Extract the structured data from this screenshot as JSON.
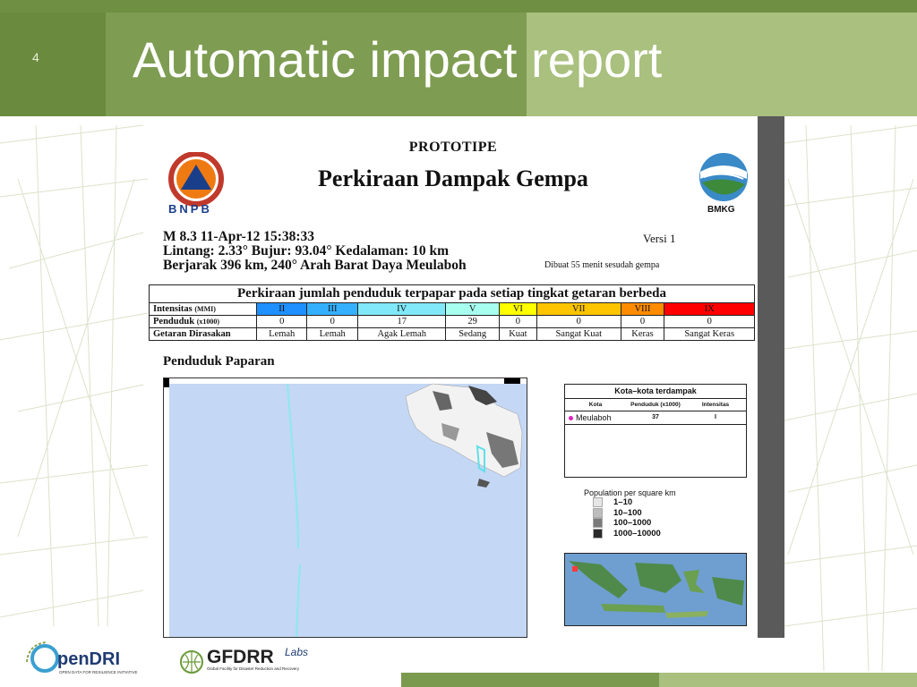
{
  "slide": {
    "number": "4",
    "title": "Automatic impact report"
  },
  "document": {
    "prototipe": "PROTOTIPE",
    "title": "Perkiraan Dampak Gempa",
    "bnpb_label": "BNPB",
    "bmkg_label": "BMKG",
    "quake_line1": "M 8.3 11-Apr-12 15:38:33",
    "quake_line2": "Lintang: 2.33° Bujur: 93.04° Kedalaman: 10 km",
    "quake_line3": "Berjarak 396 km, 240° Arah Barat Daya Meulaboh",
    "versi": "Versi 1",
    "dibuat": "Dibuat 55 menit sesudah gempa",
    "table_caption": "Perkiraan jumlah penduduk terpapar pada setiap tingkat getaran berbeda",
    "row_labels": {
      "intensitas": "Intensitas",
      "intensitas_unit": "(MMI)",
      "penduduk": "Penduduk",
      "penduduk_unit": "(x1000)",
      "getaran": "Getaran Dirasakan"
    },
    "intensity_levels": [
      {
        "level": "II",
        "penduduk": "0",
        "getaran": "Lemah",
        "color": "#1e90ff"
      },
      {
        "level": "III",
        "penduduk": "0",
        "getaran": "Lemah",
        "color": "#35b0ff"
      },
      {
        "level": "IV",
        "penduduk": "17",
        "getaran": "Agak Lemah",
        "color": "#80e8f8"
      },
      {
        "level": "V",
        "penduduk": "29",
        "getaran": "Sedang",
        "color": "#a8fff0"
      },
      {
        "level": "VI",
        "penduduk": "0",
        "getaran": "Kuat",
        "color": "#ffff00"
      },
      {
        "level": "VII",
        "penduduk": "0",
        "getaran": "Sangat Kuat",
        "color": "#ffc400"
      },
      {
        "level": "VIII",
        "penduduk": "0",
        "getaran": "Keras",
        "color": "#ff8c00"
      },
      {
        "level": "IX",
        "penduduk": "0",
        "getaran": "Sangat Keras",
        "color": "#ff0000"
      }
    ],
    "section_title": "Penduduk Paparan",
    "kota": {
      "title": "Kota–kota terdampak",
      "headers": [
        "Kota",
        "Penduduk (x1000)",
        "Intensitas"
      ],
      "rows": [
        {
          "kota": "Meulaboh",
          "penduduk": "37",
          "intensitas": "I"
        }
      ]
    },
    "population_legend": {
      "title": "Population per square km",
      "items": [
        {
          "label": "1–10",
          "color": "#e6e6e6"
        },
        {
          "label": "10–100",
          "color": "#bdbdbd"
        },
        {
          "label": "100–1000",
          "color": "#7a7a7a"
        },
        {
          "label": "1000–10000",
          "color": "#2a2a2a"
        }
      ]
    }
  },
  "footer": {
    "opendri": "penDRI",
    "opendri_sub": "OPEN DATA FOR RESILIENCE INITIATIVE",
    "gfdrr": "GFDRR",
    "gfdrr_sub": "Global Facility for Disaster Reduction and Recovery",
    "labs": "Labs"
  }
}
